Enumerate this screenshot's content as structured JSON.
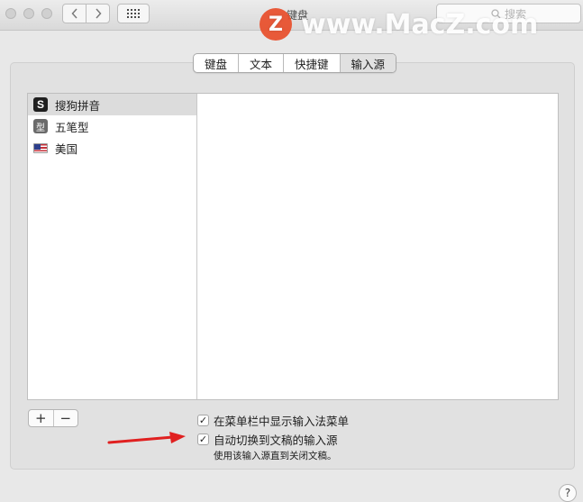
{
  "window": {
    "title": "键盘"
  },
  "toolbar": {
    "back_icon": "chevron-left-icon",
    "forward_icon": "chevron-right-icon",
    "grid_icon": "grid-icon",
    "search_placeholder": "搜索"
  },
  "watermark": {
    "logo_letter": "Z",
    "text": "www.MacZ.com"
  },
  "tabs": [
    {
      "label": "键盘",
      "active": false
    },
    {
      "label": "文本",
      "active": false
    },
    {
      "label": "快捷键",
      "active": false
    },
    {
      "label": "输入源",
      "active": true
    }
  ],
  "input_sources": [
    {
      "label": "搜狗拼音",
      "icon": "sogou-icon",
      "icon_glyph": "S",
      "selected": true
    },
    {
      "label": "五笔型",
      "icon": "wubi-icon",
      "icon_glyph": "型",
      "selected": false
    },
    {
      "label": "美国",
      "icon": "us-flag-icon",
      "icon_glyph": "",
      "selected": false
    }
  ],
  "list_controls": {
    "add": "+",
    "remove": "−"
  },
  "options": {
    "show_menu": {
      "label": "在菜单栏中显示输入法菜单",
      "checked": true
    },
    "auto_switch": {
      "label": "自动切换到文稿的输入源",
      "checked": true
    },
    "auto_switch_note": "使用该输入源直到关闭文稿。"
  },
  "help": {
    "label": "?"
  },
  "colors": {
    "arrow": "#e02020",
    "selected_row": "#dcdcdc",
    "watermark_logo": "#e94e2b"
  }
}
